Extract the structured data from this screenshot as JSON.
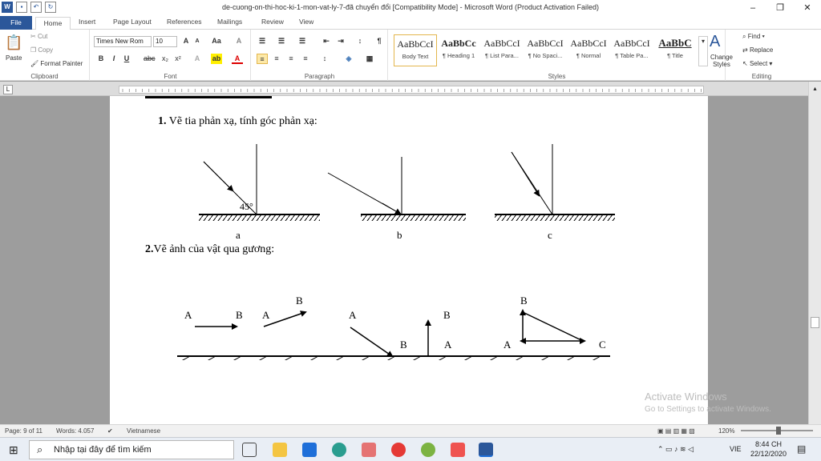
{
  "window": {
    "title": "de-cuong-on-thi-hoc-ki-1-mon-vat-ly-7-đã chuyển đổi [Compatibility Mode]  -  Microsoft Word (Product Activation Failed)",
    "controls": [
      "–",
      "❐",
      "✕"
    ]
  },
  "tabs": [
    "File",
    "Home",
    "Insert",
    "Page Layout",
    "References",
    "Mailings",
    "Review",
    "View"
  ],
  "ribbon": {
    "clipboard": {
      "paste": "Paste",
      "cut": "Cut",
      "copy": "Copy",
      "format_painter": "Format Painter",
      "label": "Clipboard"
    },
    "font": {
      "name": "Times New Rom",
      "size": "10",
      "label": "Font"
    },
    "paragraph": {
      "label": "Paragraph"
    },
    "styles": {
      "label": "Styles",
      "items": [
        {
          "sample": "AaBbCcI",
          "name": "Body Text"
        },
        {
          "sample": "AaBbCc",
          "name": "¶ Heading 1"
        },
        {
          "sample": "AaBbCcI",
          "name": "¶ List Para..."
        },
        {
          "sample": "AaBbCcI",
          "name": "¶ No Spaci..."
        },
        {
          "sample": "AaBbCcI",
          "name": "¶ Normal"
        },
        {
          "sample": "AaBbCcI",
          "name": "¶ Table Pa..."
        },
        {
          "sample": "AaBbC",
          "name": "¶ Title"
        }
      ],
      "change_styles": "Change Styles"
    },
    "editing": {
      "find": "Find",
      "replace": "Replace",
      "select": "Select",
      "label": "Editing"
    }
  },
  "document": {
    "q1_number": "1.",
    "q1": "Vẽ tia phản xạ, tính góc phản xạ:",
    "angle": "45°",
    "fig_labels": [
      "a",
      "b",
      "c"
    ],
    "q2_number": "2.",
    "q2": "Vẽ ảnh của vật qua gương:",
    "points": {
      "A": "A",
      "B": "B",
      "C": "C"
    }
  },
  "watermark": {
    "line1": "Activate Windows",
    "line2": "Go to Settings to activate Windows."
  },
  "status": {
    "page": "Page: 9 of 11",
    "words": "Words: 4.057",
    "language": "Vietnamese",
    "zoom": "120%"
  },
  "taskbar": {
    "search_placeholder": "Nhập tại đây để tìm kiếm",
    "lang": "VIE",
    "time": "8:44 CH",
    "date": "22/12/2020"
  }
}
